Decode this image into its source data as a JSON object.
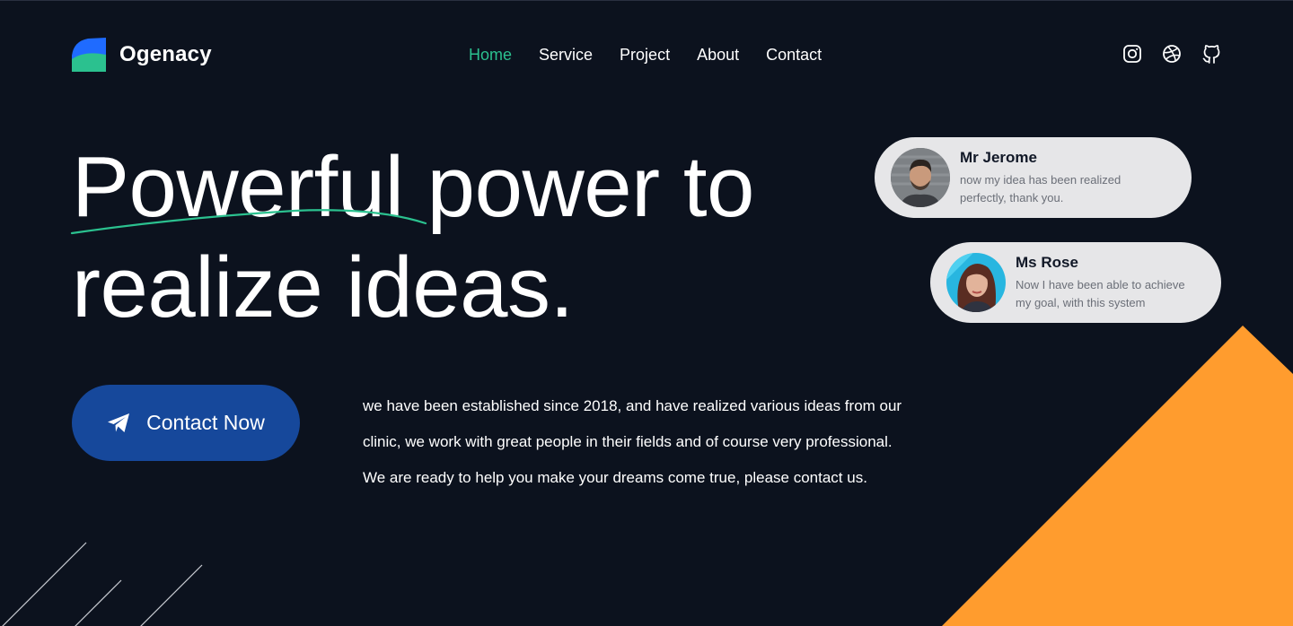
{
  "brand": {
    "name": "Ogenacy",
    "colors": {
      "primary_green": "#2bc18f",
      "primary_blue": "#1f6bff",
      "accent_orange": "#ff9c2e",
      "button_blue": "#16489b"
    }
  },
  "nav": {
    "items": [
      {
        "label": "Home",
        "active": true
      },
      {
        "label": "Service",
        "active": false
      },
      {
        "label": "Project",
        "active": false
      },
      {
        "label": "About",
        "active": false
      },
      {
        "label": "Contact",
        "active": false
      }
    ]
  },
  "socials": [
    "instagram-icon",
    "dribbble-icon",
    "github-icon"
  ],
  "hero": {
    "title_line1_highlight": "Powerful",
    "title_line1_rest": "power to",
    "title_line2": "realize ideas.",
    "cta_label": "Contact Now",
    "cta_icon": "paper-plane-icon",
    "description": [
      "we have been established since 2018, and have realized various ideas from our",
      "clinic, we work with great people in their fields and of course very professional.",
      "We are ready to help you make your dreams come true, please contact us."
    ]
  },
  "testimonials": [
    {
      "name": "Mr Jerome",
      "message_line1": "now my idea has been realized",
      "message_line2": "perfectly, thank you."
    },
    {
      "name": "Ms Rose",
      "message_line1": "Now I have been able to achieve",
      "message_line2": "my goal, with this system"
    }
  ]
}
